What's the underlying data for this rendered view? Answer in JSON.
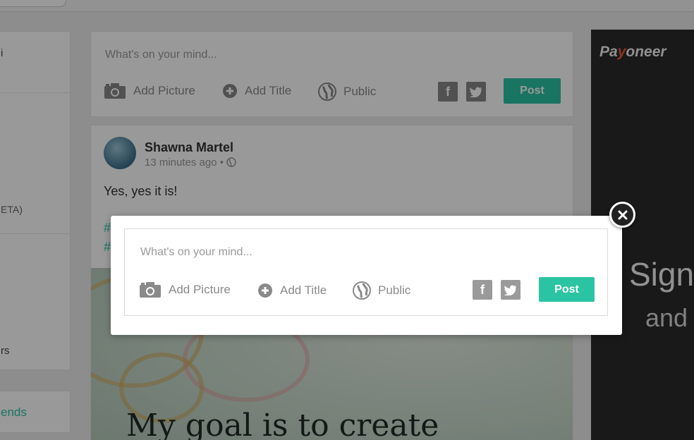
{
  "left_sidebar": {
    "fragments": [
      "i",
      "ETA)",
      "rs"
    ],
    "friends_link": "ends"
  },
  "composer": {
    "placeholder": "What's on your mind...",
    "add_picture": "Add Picture",
    "add_title": "Add Title",
    "privacy": "Public",
    "facebook_icon": "facebook-icon",
    "twitter_icon": "twitter-icon",
    "post_label": "Post"
  },
  "feed_post": {
    "author": "Shawna Martel",
    "time": "13 minutes ago",
    "text": "Yes, yes it is!",
    "hashtag_fragment_1": "#",
    "hashtag_fragment_2": "#",
    "image_caption": "My goal is to create"
  },
  "ad": {
    "brand_prefix": "Pa",
    "brand_y": "y",
    "brand_suffix": "oneer",
    "headline_fragment": "Sign",
    "subline_fragment": "and"
  },
  "modal": {
    "placeholder": "What's on your mind...",
    "add_picture": "Add Picture",
    "add_title": "Add Title",
    "privacy": "Public",
    "post_label": "Post",
    "close_icon": "close-icon"
  },
  "colors": {
    "accent": "#2bc4a2",
    "ad_background": "#2a2a2a",
    "overlay": "rgba(0,0,0,0.4)"
  }
}
